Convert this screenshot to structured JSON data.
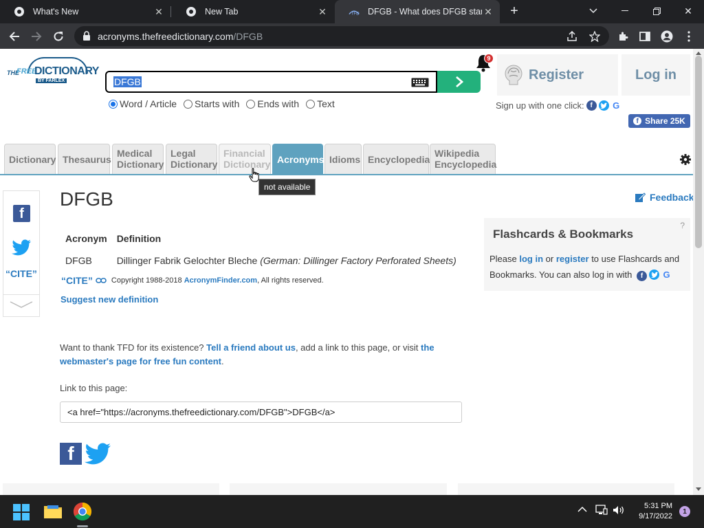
{
  "browser": {
    "tabs": [
      {
        "title": "What's New"
      },
      {
        "title": "New Tab"
      },
      {
        "title": "DFGB - What does DFGB stand fo"
      }
    ],
    "url_host": "acronyms.thefreedictionary.com",
    "url_path": "/DFGB"
  },
  "header": {
    "logo": {
      "the": "THE",
      "free": "FREE",
      "dictionary": "DICTIONARY",
      "by": "BY FARLEX"
    },
    "search_value": "DFGB",
    "radio_options": [
      {
        "label": "Word / Article",
        "checked": true
      },
      {
        "label": "Starts with",
        "checked": false
      },
      {
        "label": "Ends with",
        "checked": false
      },
      {
        "label": "Text",
        "checked": false
      }
    ],
    "notification_count": "9",
    "register_label": "Register",
    "login_label": "Log in",
    "signup_text": "Sign up with one click:",
    "share_label": "Share 25K"
  },
  "nav_tabs": [
    {
      "line1": "Dictionary",
      "line2": "",
      "state": "normal"
    },
    {
      "line1": "Thesaurus",
      "line2": "",
      "state": "normal"
    },
    {
      "line1": "Medical",
      "line2": "Dictionary",
      "state": "normal"
    },
    {
      "line1": "Legal",
      "line2": "Dictionary",
      "state": "normal"
    },
    {
      "line1": "Financial",
      "line2": "Dictionary",
      "state": "disabled"
    },
    {
      "line1": "Acronyms",
      "line2": "",
      "state": "active"
    },
    {
      "line1": "Idioms",
      "line2": "",
      "state": "normal"
    },
    {
      "line1": "Encyclopedia",
      "line2": "",
      "state": "normal"
    },
    {
      "line1": "Wikipedia",
      "line2": "Encyclopedia",
      "state": "normal"
    }
  ],
  "tooltip": "not available",
  "sidebar": {
    "cite_label": "“CITE”"
  },
  "main": {
    "term": "DFGB",
    "feedback_label": "Feedback",
    "table_headers": [
      "Acronym",
      "Definition"
    ],
    "rows": [
      {
        "acronym": "DFGB",
        "definition": "Dillinger Fabrik Gelochter Bleche",
        "note": "(German: Dillinger Factory Perforated Sheets)"
      }
    ],
    "cite_label": "“CITE”",
    "copyright_pre": "Copyright 1988-2018",
    "copyright_link": "AcronymFinder.com",
    "copyright_post": ", All rights reserved.",
    "suggest_label": "Suggest new definition",
    "thank_pre": "Want to thank TFD for its existence?",
    "thank_link1": "Tell a friend about us",
    "thank_mid": ", add a link to this page, or visit",
    "thank_link2": "the webmaster's page for free fun content",
    "thank_post": ".",
    "link_label": "Link to this page:",
    "link_code": "<a href=\"https://acronyms.thefreedictionary.com/DFGB\">DFGB</a>"
  },
  "flashcards": {
    "help": "?",
    "title": "Flashcards & Bookmarks",
    "pre": "Please",
    "login": "log in",
    "or": "or",
    "register": "register",
    "post": "to use Flashcards and Bookmarks. You can also log in with"
  },
  "taskbar": {
    "time": "5:31 PM",
    "date": "9/17/2022",
    "notifications": "1"
  }
}
